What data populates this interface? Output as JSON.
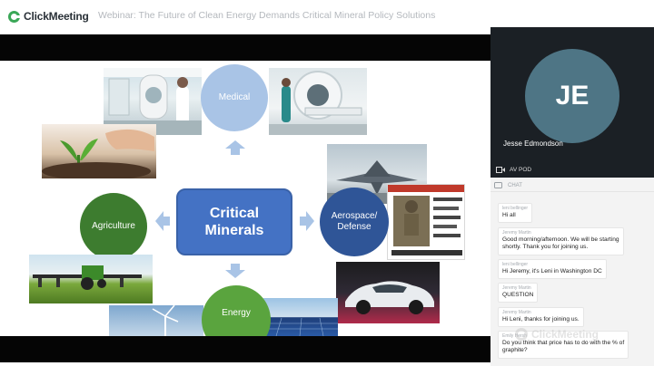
{
  "header": {
    "logo_text": "ClickMeeting",
    "title": "Webinar: The Future of Clean Energy Demands Critical Mineral Policy Solutions"
  },
  "slide": {
    "hub_line1": "Critical",
    "hub_line2": "Minerals",
    "circles": {
      "medical": "Medical",
      "agriculture": "Agriculture",
      "aerospace_line1": "Aerospace/",
      "aerospace_line2": "Defense",
      "energy": "Energy"
    },
    "colors": {
      "hub": "#4472c4",
      "medical": "#a9c4e6",
      "agriculture": "#3d7c2f",
      "aerospace": "#2f5597",
      "energy": "#5aa43e",
      "arrows": "#a9c4e6"
    }
  },
  "video": {
    "initials": "JE",
    "name": "Jesse Edmondson",
    "bar_label": "AV POD",
    "bar_icon": "camera-icon"
  },
  "chat": {
    "header": "CHAT",
    "header_icon": "chat-icon",
    "messages": [
      {
        "author": "leni bellinger",
        "text": [
          "Hi all"
        ]
      },
      {
        "author": "Jeremy Martin",
        "text": [
          "Good morning/afternoon. We will be starting",
          "shortly. Thank you for joining us."
        ]
      },
      {
        "author": "leni bellinger",
        "text": [
          "Hi Jeremy, it's Leni in Washington DC"
        ]
      },
      {
        "author": "Jeremy Martin",
        "text": [
          "QUESTION"
        ]
      },
      {
        "author": "Jeremy Martin",
        "text": [
          "Hi Leni, thanks for joining us."
        ]
      },
      {
        "author": "Emily Hersh",
        "text": [
          "Do you think that price has to do with the % of",
          "graphite?"
        ]
      }
    ]
  },
  "watermark": "ClickMeeting"
}
